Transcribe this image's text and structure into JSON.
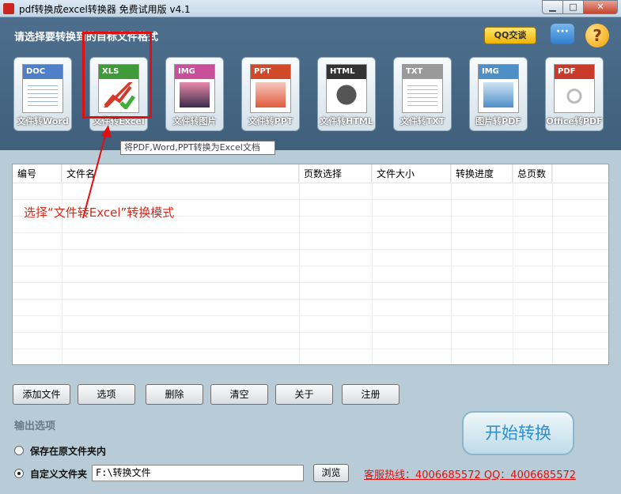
{
  "window": {
    "title": "pdf转换成excel转换器 免费试用版 v4.1",
    "min": "▁",
    "max": "□",
    "close": "✕"
  },
  "header": {
    "label": "请选择要转换到的目标文件格式",
    "qq_label": "QQ交谈",
    "chat_icon": "···",
    "help_icon": "?"
  },
  "formats": [
    {
      "tag": "DOC",
      "label": "文件转Word",
      "color": "#4f7fc8"
    },
    {
      "tag": "XLS",
      "label": "文件转Excel",
      "color": "#3f9a3a"
    },
    {
      "tag": "IMG",
      "label": "文件转图片",
      "color": "#c84f9a"
    },
    {
      "tag": "PPT",
      "label": "文件转PPT",
      "color": "#d04a2a"
    },
    {
      "tag": "HTML",
      "label": "文件转HTML",
      "color": "#333333"
    },
    {
      "tag": "TXT",
      "label": "文件转TXT",
      "color": "#9a9a9a"
    },
    {
      "tag": "IMG",
      "label": "图片转PDF",
      "color": "#4f8fc8"
    },
    {
      "tag": "PDF",
      "label": "Office转PDF",
      "color": "#c83a2a"
    }
  ],
  "tooltip": "将PDF,Word,PPT转换为Excel文档",
  "table": {
    "columns": [
      "编号",
      "文件名",
      "页数选择",
      "文件大小",
      "转换进度",
      "总页数"
    ]
  },
  "annotation": "选择“文件转Excel”转换模式",
  "buttons": {
    "add": "添加文件",
    "options": "选项",
    "delete": "删除",
    "clear": "清空",
    "about": "关于",
    "register": "注册",
    "browse": "浏览",
    "start": "开始转换"
  },
  "output": {
    "label": "输出选项",
    "opt1": "保存在原文件夹内",
    "opt2": "自定义文件夹",
    "path": "F:\\转换文件"
  },
  "hotline": "客服热线：4006685572 QQ：4006685572"
}
